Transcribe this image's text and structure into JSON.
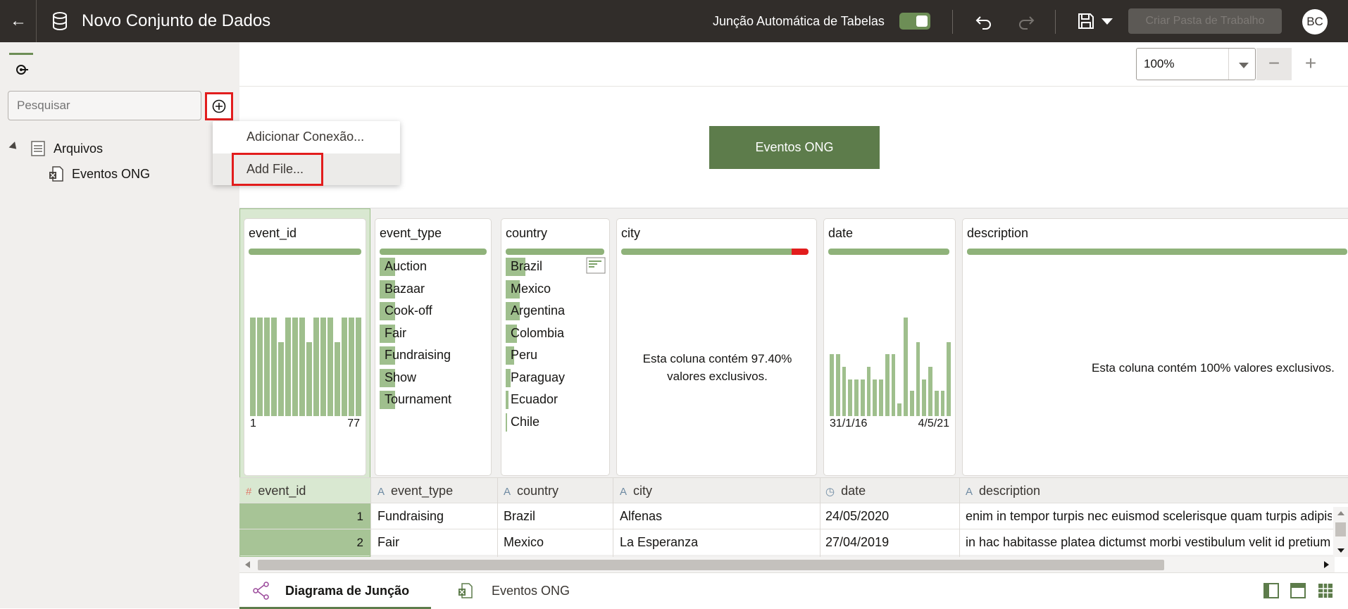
{
  "header": {
    "title": "Novo Conjunto de Dados",
    "auto_join_label": "Junção Automática de Tabelas",
    "create_workbook_label": "Criar Pasta de Trabalho",
    "avatar_initials": "BC"
  },
  "sidebar": {
    "search_placeholder": "Pesquisar",
    "tree": {
      "folder_label": "Arquivos",
      "file_label": "Eventos ONG"
    },
    "add_menu": {
      "items": [
        "Adicionar Conexão...",
        "Add File..."
      ]
    }
  },
  "canvas": {
    "zoom_value": "100%",
    "zoom_minus": "−",
    "zoom_plus": "+",
    "table_node_label": "Eventos ONG"
  },
  "columns": [
    {
      "name": "event_id",
      "type_icon": "#"
    },
    {
      "name": "event_type",
      "type_icon": "A"
    },
    {
      "name": "country",
      "type_icon": "A"
    },
    {
      "name": "city",
      "type_icon": "A"
    },
    {
      "name": "date",
      "type_icon": "clock"
    },
    {
      "name": "description",
      "type_icon": "A"
    }
  ],
  "profiles": {
    "event_id": {
      "axis_min": "1",
      "axis_max": "77"
    },
    "event_type": {
      "categories": [
        "Auction",
        "Bazaar",
        "Cook-off",
        "Fair",
        "Fundraising",
        "Show",
        "Tournament"
      ]
    },
    "country": {
      "categories": [
        "Brazil",
        "Mexico",
        "Argentina",
        "Colombia",
        "Peru",
        "Paraguay",
        "Ecuador",
        "Chile"
      ]
    },
    "city": {
      "unique_text_1": "Esta coluna contém 97.40%",
      "unique_text_2": "valores exclusivos."
    },
    "date": {
      "axis_min": "31/1/16",
      "axis_max": "4/5/21"
    },
    "description": {
      "unique_text": "Esta coluna contém 100% valores exclusivos."
    }
  },
  "rows": [
    {
      "num": "1",
      "event_type": "Fundraising",
      "country": "Brazil",
      "city": "Alfenas",
      "date": "24/05/2020",
      "description": "enim in tempor turpis nec euismod scelerisque quam turpis adipiscing"
    },
    {
      "num": "2",
      "event_type": "Fair",
      "country": "Mexico",
      "city": "La Esperanza",
      "date": "27/04/2019",
      "description": "in hac habitasse platea dictumst morbi vestibulum velit id pretium"
    }
  ],
  "bottom_tabs": {
    "join_diagram": "Diagrama de Junção",
    "table_tab": "Eventos ONG"
  },
  "colors": {
    "accent": "#5d7c4b",
    "bar": "#9fbf8d",
    "highlight": "#e21d1d"
  }
}
